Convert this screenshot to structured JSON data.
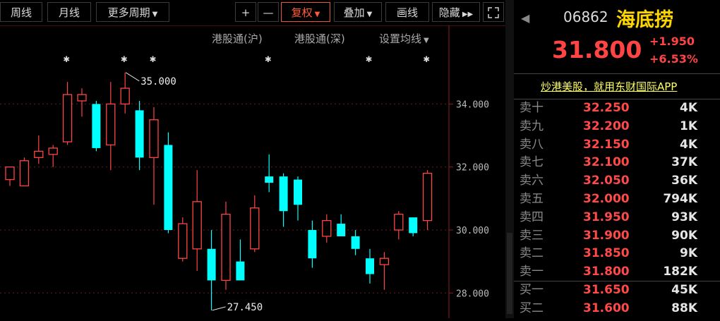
{
  "toolbar": {
    "weekly": "周线",
    "monthly": "月线",
    "more_periods": "更多周期",
    "plus": "+",
    "minus": "—",
    "adjust": "复权",
    "overlay": "叠加",
    "draw_line": "画线",
    "hide": "隐藏",
    "fullscreen_icon": "expand-icon"
  },
  "sublinks": {
    "sh_connect": "港股通(沪)",
    "sz_connect": "港股通(深)",
    "ma_settings": "设置均线"
  },
  "quote": {
    "code": "06862",
    "name": "海底捞",
    "price": "31.800",
    "change": "+1.950",
    "change_pct": "+6.53%",
    "promo": "炒港美股，就用东财国际APP"
  },
  "orderbook": [
    {
      "label": "卖十",
      "price": "32.250",
      "vol": "4K"
    },
    {
      "label": "卖九",
      "price": "32.200",
      "vol": "1K"
    },
    {
      "label": "卖八",
      "price": "32.150",
      "vol": "4K"
    },
    {
      "label": "卖七",
      "price": "32.100",
      "vol": "37K"
    },
    {
      "label": "卖六",
      "price": "32.050",
      "vol": "36K"
    },
    {
      "label": "卖五",
      "price": "32.000",
      "vol": "794K"
    },
    {
      "label": "卖四",
      "price": "31.950",
      "vol": "93K"
    },
    {
      "label": "卖三",
      "price": "31.900",
      "vol": "90K"
    },
    {
      "label": "卖二",
      "price": "31.850",
      "vol": "9K"
    },
    {
      "label": "卖一",
      "price": "31.800",
      "vol": "182K"
    },
    {
      "label": "买一",
      "price": "31.650",
      "vol": "45K"
    },
    {
      "label": "买二",
      "price": "31.600",
      "vol": "88K"
    }
  ],
  "colors": {
    "up": "#ff4444",
    "down": "#00ffff",
    "accent": "#ff5a3c",
    "promo": "#ffff66"
  },
  "chart_data": {
    "type": "candlestick",
    "title": "",
    "xlabel": "",
    "ylabel": "",
    "ylim": [
      27.2,
      35.6
    ],
    "yticks": [
      "34.000",
      "32.000",
      "30.000",
      "28.000"
    ],
    "grid": true,
    "annotations": [
      {
        "text": "35.000",
        "candle": 8
      },
      {
        "text": "27.450",
        "candle": 14
      }
    ],
    "marker_candles": [
      4,
      8,
      10,
      18,
      25,
      29
    ],
    "candles": [
      {
        "o": 31.6,
        "h": 32.0,
        "l": 31.4,
        "c": 32.0
      },
      {
        "o": 31.4,
        "h": 32.3,
        "l": 31.4,
        "c": 32.2
      },
      {
        "o": 32.3,
        "h": 33.0,
        "l": 32.1,
        "c": 32.5
      },
      {
        "o": 32.4,
        "h": 32.7,
        "l": 32.0,
        "c": 32.6
      },
      {
        "o": 32.8,
        "h": 34.7,
        "l": 32.7,
        "c": 34.3
      },
      {
        "o": 34.1,
        "h": 34.5,
        "l": 33.6,
        "c": 34.3
      },
      {
        "o": 34.0,
        "h": 34.1,
        "l": 32.5,
        "c": 32.6
      },
      {
        "o": 32.7,
        "h": 34.7,
        "l": 31.9,
        "c": 34.0
      },
      {
        "o": 34.0,
        "h": 35.0,
        "l": 33.7,
        "c": 34.5
      },
      {
        "o": 33.8,
        "h": 34.1,
        "l": 31.9,
        "c": 32.3
      },
      {
        "o": 32.3,
        "h": 33.9,
        "l": 30.8,
        "c": 33.5
      },
      {
        "o": 32.7,
        "h": 33.1,
        "l": 29.9,
        "c": 30.0
      },
      {
        "o": 29.1,
        "h": 30.4,
        "l": 29.0,
        "c": 30.2
      },
      {
        "o": 29.4,
        "h": 31.9,
        "l": 28.7,
        "c": 30.9
      },
      {
        "o": 29.4,
        "h": 30.0,
        "l": 27.45,
        "c": 28.4
      },
      {
        "o": 28.4,
        "h": 30.9,
        "l": 28.1,
        "c": 30.5
      },
      {
        "o": 29.0,
        "h": 29.7,
        "l": 28.6,
        "c": 28.4
      },
      {
        "o": 29.4,
        "h": 31.1,
        "l": 29.3,
        "c": 30.7
      },
      {
        "o": 31.7,
        "h": 32.4,
        "l": 31.2,
        "c": 31.5
      },
      {
        "o": 31.7,
        "h": 31.8,
        "l": 30.1,
        "c": 30.6
      },
      {
        "o": 31.6,
        "h": 31.7,
        "l": 30.3,
        "c": 30.8
      },
      {
        "o": 30.0,
        "h": 30.3,
        "l": 28.8,
        "c": 29.1
      },
      {
        "o": 29.8,
        "h": 30.5,
        "l": 29.6,
        "c": 30.3
      },
      {
        "o": 30.2,
        "h": 30.5,
        "l": 29.8,
        "c": 29.8
      },
      {
        "o": 29.8,
        "h": 30.0,
        "l": 29.2,
        "c": 29.4
      },
      {
        "o": 29.1,
        "h": 29.4,
        "l": 28.3,
        "c": 28.6
      },
      {
        "o": 28.9,
        "h": 29.3,
        "l": 28.1,
        "c": 29.1
      },
      {
        "o": 30.0,
        "h": 30.6,
        "l": 29.7,
        "c": 30.5
      },
      {
        "o": 30.4,
        "h": 30.4,
        "l": 29.8,
        "c": 29.9
      },
      {
        "o": 30.3,
        "h": 31.9,
        "l": 30.0,
        "c": 31.8
      }
    ]
  }
}
